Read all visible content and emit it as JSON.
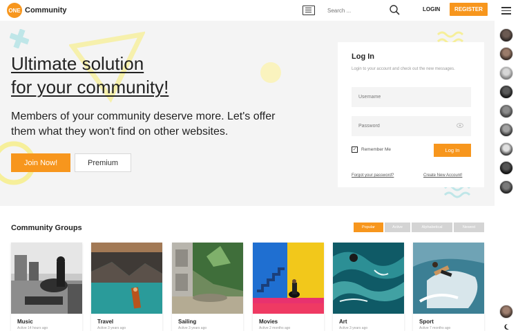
{
  "header": {
    "logo_badge": "ONE",
    "logo_text": "Community",
    "search_placeholder": "Search ...",
    "login_label": "LOGIN",
    "register_label": "REGISTER"
  },
  "hero": {
    "title_line1": "Ultimate solution",
    "title_line2": "for your community!",
    "subtitle": "Members of your community deserve more. Let's offer them what they won't find on other websites.",
    "join_label": "Join Now!",
    "premium_label": "Premium"
  },
  "login": {
    "title": "Log In",
    "description": "Login to your account and check out the new messages.",
    "username_placeholder": "Username",
    "password_placeholder": "Password",
    "remember_label": "Remember Me",
    "remember_checked": true,
    "submit_label": "Log In",
    "forgot_label": "Forgot your password?",
    "create_label": "Create New Account!"
  },
  "groups": {
    "title": "Community Groups",
    "tabs": [
      {
        "label": "Popular",
        "active": true
      },
      {
        "label": "Active",
        "active": false
      },
      {
        "label": "Alphabetical",
        "active": false
      },
      {
        "label": "Newest",
        "active": false
      }
    ],
    "items": [
      {
        "name": "Music",
        "meta": "Active 14 hours ago"
      },
      {
        "name": "Travel",
        "meta": "Active 3 years ago"
      },
      {
        "name": "Sailing",
        "meta": "Active 3 years ago"
      },
      {
        "name": "Movies",
        "meta": "Active 2 months ago"
      },
      {
        "name": "Art",
        "meta": "Active 3 years ago"
      },
      {
        "name": "Sport",
        "meta": "Active 7 months ago"
      }
    ]
  },
  "sidebar": {
    "menu_icon": "hamburger-icon",
    "member_count": 9
  },
  "colors": {
    "accent": "#f7961d",
    "tab_inactive": "#d4d4d4",
    "background": "#f4f4f4"
  }
}
